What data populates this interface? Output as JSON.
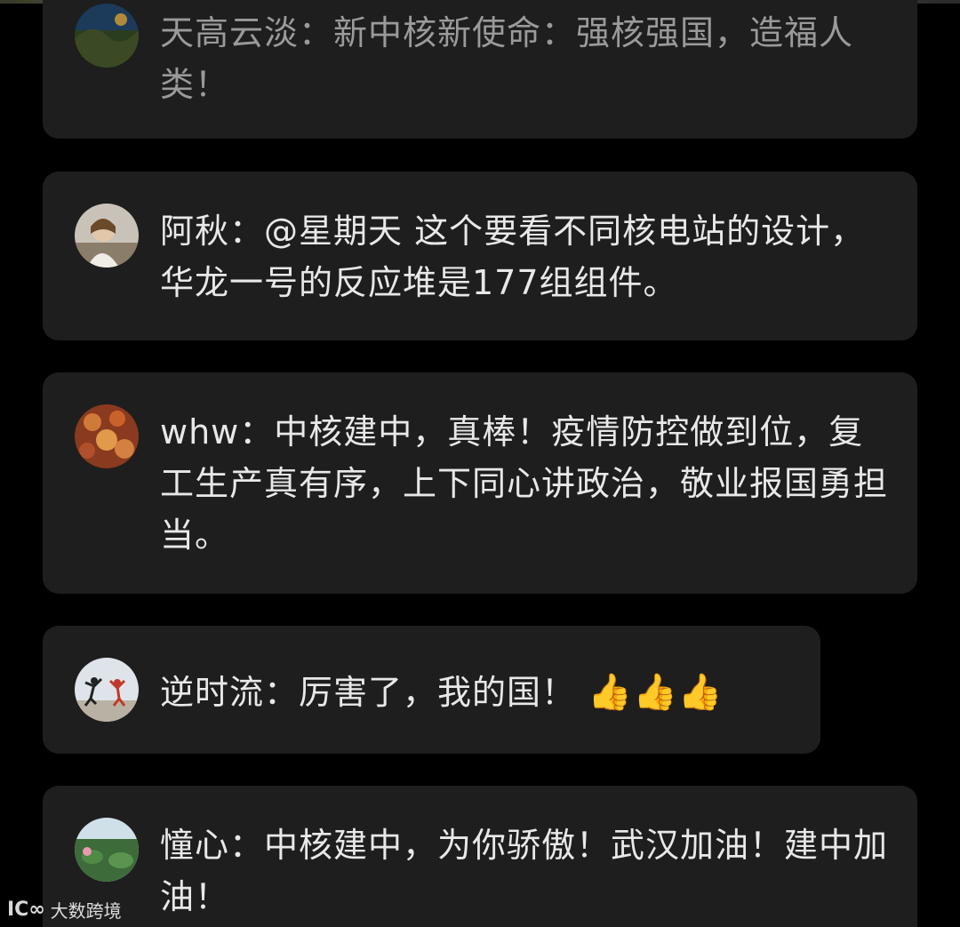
{
  "comments": [
    {
      "author": "天高云淡",
      "separator": "：",
      "text": "新中核新使命：强核强国，造福人类！",
      "reactions": ""
    },
    {
      "author": "阿秋",
      "separator": "：",
      "text": "@星期天 这个要看不同核电站的设计，华龙一号的反应堆是177组组件。",
      "reactions": ""
    },
    {
      "author": "whw",
      "separator": "：",
      "text": "中核建中，真棒！疫情防控做到位，复工生产真有序，上下同心讲政治，敬业报国勇担当。",
      "reactions": ""
    },
    {
      "author": "逆时流",
      "separator": "：",
      "text": "厉害了，我的国！",
      "reactions": "👍👍👍"
    },
    {
      "author": "憧心",
      "separator": "：",
      "text": "中核建中，为你骄傲！武汉加油！建中加油！",
      "reactions": ""
    }
  ],
  "watermark": {
    "logo": "ⅠⅭ∞",
    "text": "大数跨境"
  }
}
